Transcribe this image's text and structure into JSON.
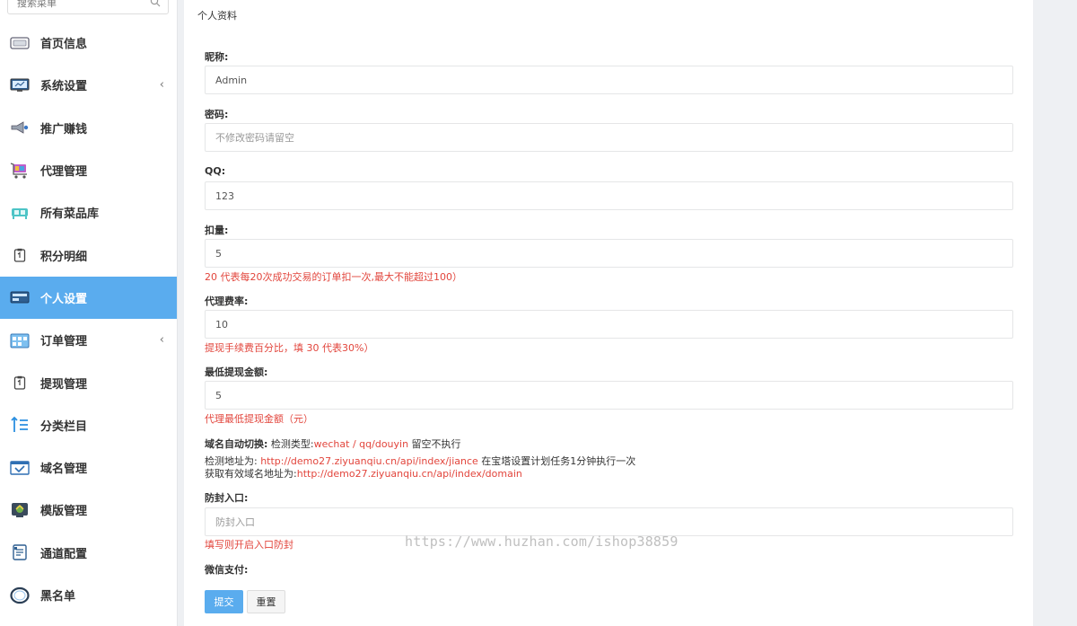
{
  "sidebar": {
    "search": {
      "placeholder": "搜索菜单"
    },
    "items": [
      {
        "label": "首页信息",
        "icon": "card-icon",
        "chevron": ""
      },
      {
        "label": "系统设置",
        "icon": "monitor-icon",
        "chevron": "‹"
      },
      {
        "label": "推广赚钱",
        "icon": "megaphone-icon",
        "chevron": ""
      },
      {
        "label": "代理管理",
        "icon": "cart-icon",
        "chevron": ""
      },
      {
        "label": "所有菜品库",
        "icon": "tray-icon",
        "chevron": ""
      },
      {
        "label": "积分明细",
        "icon": "clipboard-icon",
        "chevron": ""
      },
      {
        "label": "个人设置",
        "icon": "id-card-icon",
        "chevron": ""
      },
      {
        "label": "订单管理",
        "icon": "calendar-icon",
        "chevron": "‹"
      },
      {
        "label": "提现管理",
        "icon": "clipboard-icon",
        "chevron": ""
      },
      {
        "label": "分类栏目",
        "icon": "sort-arrows-icon",
        "chevron": ""
      },
      {
        "label": "域名管理",
        "icon": "window-check-icon",
        "chevron": ""
      },
      {
        "label": "模版管理",
        "icon": "template-icon",
        "chevron": ""
      },
      {
        "label": "通道配置",
        "icon": "document-icon",
        "chevron": ""
      },
      {
        "label": "黑名单",
        "icon": "ring-icon",
        "chevron": ""
      }
    ],
    "active_index": 6,
    "accent": "#5aacee"
  },
  "main": {
    "title": "个人资料",
    "fields": {
      "nickname": {
        "label": "昵称:",
        "value": "Admin",
        "placeholder": ""
      },
      "password": {
        "label": "密码:",
        "value": "",
        "placeholder": "不修改密码请留空"
      },
      "qq": {
        "label": "QQ:",
        "value": "123",
        "placeholder": ""
      },
      "deduct": {
        "label": "扣量:",
        "value": "5",
        "placeholder": "",
        "help": "20 代表每20次成功交易的订单扣一次,最大不能超过100）"
      },
      "agent_rate": {
        "label": "代理费率:",
        "value": "10",
        "placeholder": "",
        "help": "提现手续费百分比，填 30 代表30%）"
      },
      "min_withdraw": {
        "label": "最低提现金额:",
        "value": "5",
        "placeholder": "",
        "help": "代理最低提现金额（元）"
      },
      "anti_block": {
        "label": "防封入口:",
        "value": "",
        "placeholder": "防封入口",
        "help": "填写则开启入口防封"
      },
      "wechat_pay": {
        "label": "微信支付:"
      }
    },
    "domain_switch": {
      "label": "域名自动切换:",
      "type_prefix": "检测类型:",
      "types": "wechat / qq/douyin",
      "empty_note": " 留空不执行",
      "check_prefix": "检测地址为: ",
      "check_url": "http://demo27.ziyuanqiu.cn/api/index/jiance",
      "check_note": " 在宝塔设置计划任务1分钟执行一次",
      "valid_prefix": "获取有效域名地址为:",
      "valid_url": "http://demo27.ziyuanqiu.cn/api/index/domain"
    },
    "buttons": {
      "submit": "提交",
      "reset": "重置"
    },
    "watermark": "https://www.huzhan.com/ishop38859",
    "help_color": "#e2453c"
  }
}
